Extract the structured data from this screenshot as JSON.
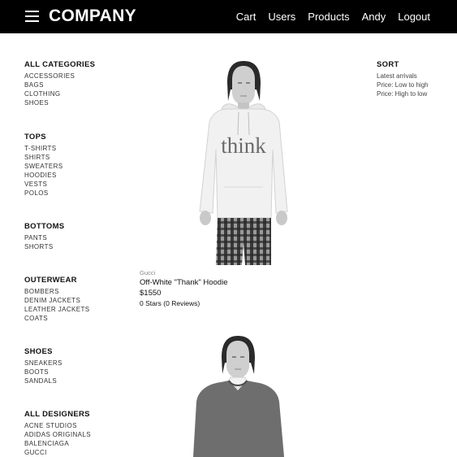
{
  "navbar": {
    "brand": "COMPANY",
    "links": [
      "Cart",
      "Users",
      "Products",
      "Andy",
      "Logout"
    ]
  },
  "categories": {
    "all": {
      "title": "ALL CATEGORIES",
      "items": [
        "ACCESSORIES",
        "BAGS",
        "CLOTHING",
        "SHOES"
      ]
    },
    "tops": {
      "title": "TOPS",
      "items": [
        "T-SHIRTS",
        "SHIRTS",
        "SWEATERS",
        "HOODIES",
        "VESTS",
        "POLOS"
      ]
    },
    "bottoms": {
      "title": "BOTTOMS",
      "items": [
        "PANTS",
        "SHORTS"
      ]
    },
    "outerwear": {
      "title": "OUTERWEAR",
      "items": [
        "BOMBERS",
        "DENIM JACKETS",
        "LEATHER JACKETS",
        "COATS"
      ]
    },
    "shoes": {
      "title": "SHOES",
      "items": [
        "SNEAKERS",
        "BOOTS",
        "SANDALS"
      ]
    },
    "designers": {
      "title": "ALL DESIGNERS",
      "items": [
        "ACNE STUDIOS",
        "ADIDAS ORIGINALS",
        "BALENCIAGA",
        "GUCCI"
      ]
    }
  },
  "sort": {
    "title": "SORT",
    "options": [
      "Latest arrivals",
      "Price: Low to high",
      "Price: High to low"
    ]
  },
  "products": [
    {
      "brand": "Gucci",
      "name": "Off-White \"Thank\" Hoodie",
      "price": "$1550",
      "rating": "0 Stars (0 Reviews)",
      "print_text": "think"
    }
  ],
  "colors": {
    "navbar_bg": "#000000",
    "navbar_text": "#ffffff"
  }
}
